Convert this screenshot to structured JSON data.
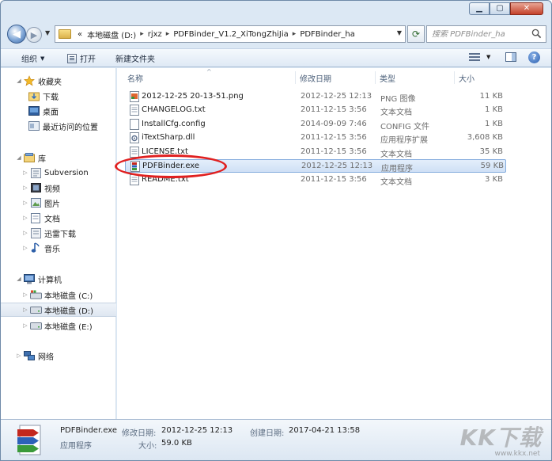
{
  "address": {
    "crumbs": [
      "«",
      "本地磁盘 (D:)",
      "rjxz",
      "PDFBinder_V1.2_XiTongZhiJia",
      "PDFBinder_ha"
    ]
  },
  "search": {
    "placeholder": "搜索 PDFBinder_ha"
  },
  "toolbar": {
    "organize": "组织",
    "open": "打开",
    "new_folder": "新建文件夹"
  },
  "nav": {
    "favorites": "收藏夹",
    "downloads": "下载",
    "desktop": "桌面",
    "recent": "最近访问的位置",
    "libraries": "库",
    "subversion": "Subversion",
    "videos": "视频",
    "pictures": "图片",
    "documents": "文档",
    "xunlei": "迅雷下载",
    "music": "音乐",
    "computer": "计算机",
    "drive_c": "本地磁盘 (C:)",
    "drive_d": "本地磁盘 (D:)",
    "drive_e": "本地磁盘 (E:)",
    "network": "网络"
  },
  "columns": {
    "name": "名称",
    "date": "修改日期",
    "type": "类型",
    "size": "大小"
  },
  "files": [
    {
      "name": "2012-12-25 20-13-51.png",
      "date": "2012-12-25 12:13",
      "type": "PNG 图像",
      "size": "11 KB",
      "icon": "png-image-icon"
    },
    {
      "name": "CHANGELOG.txt",
      "date": "2011-12-15 3:56",
      "type": "文本文档",
      "size": "1 KB",
      "icon": "text-file-icon"
    },
    {
      "name": "InstallCfg.config",
      "date": "2014-09-09 7:46",
      "type": "CONFIG 文件",
      "size": "1 KB",
      "icon": "generic-file-icon"
    },
    {
      "name": "iTextSharp.dll",
      "date": "2011-12-15 3:56",
      "type": "应用程序扩展",
      "size": "3,608 KB",
      "icon": "dll-file-icon"
    },
    {
      "name": "LICENSE.txt",
      "date": "2011-12-15 3:56",
      "type": "文本文档",
      "size": "35 KB",
      "icon": "text-file-icon"
    },
    {
      "name": "PDFBinder.exe",
      "date": "2012-12-25 12:13",
      "type": "应用程序",
      "size": "59 KB",
      "icon": "pdfbinder-app-icon"
    },
    {
      "name": "README.txt",
      "date": "2011-12-15 3:56",
      "type": "文本文档",
      "size": "3 KB",
      "icon": "text-file-icon"
    }
  ],
  "details": {
    "name": "PDFBinder.exe",
    "kind": "应用程序",
    "modified_label": "修改日期:",
    "modified": "2012-12-25 12:13",
    "created_label": "创建日期:",
    "created": "2017-04-21 13:58",
    "size_label": "大小:",
    "size": "59.0 KB"
  },
  "watermark": {
    "logo": "KK下载",
    "url": "www.kkx.net"
  },
  "colors": {
    "selection": "#cfe0f5",
    "highlight_ring": "#e02020",
    "chrome": "#dce8f4"
  }
}
